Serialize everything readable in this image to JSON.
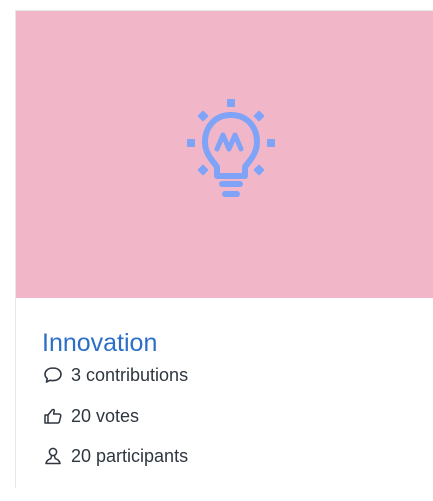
{
  "card": {
    "title": "Innovation",
    "stats": {
      "contributions": "3 contributions",
      "votes": "20 votes",
      "participants": "20 participants"
    },
    "colors": {
      "hero_background": "#f2b6c9",
      "icon_color": "#7fa3f7",
      "title_color": "#2b6fc8",
      "text_color": "#2f3640"
    },
    "icons": {
      "hero": "lightbulb-icon",
      "contributions": "comment-icon",
      "votes": "thumbs-up-icon",
      "participants": "person-icon"
    }
  }
}
